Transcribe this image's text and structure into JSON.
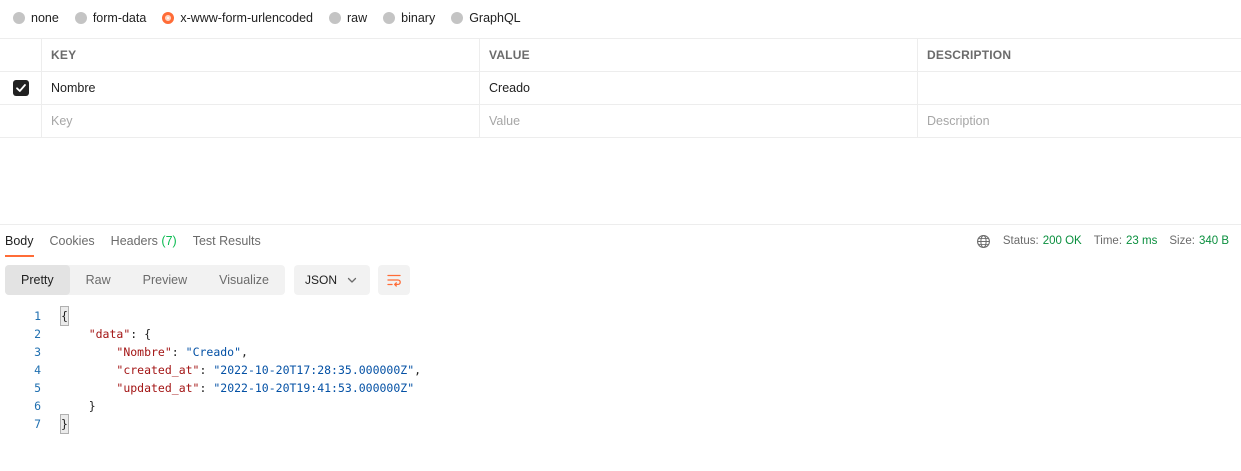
{
  "body_types": [
    {
      "label": "none",
      "selected": false
    },
    {
      "label": "form-data",
      "selected": false
    },
    {
      "label": "x-www-form-urlencoded",
      "selected": true
    },
    {
      "label": "raw",
      "selected": false
    },
    {
      "label": "binary",
      "selected": false
    },
    {
      "label": "GraphQL",
      "selected": false
    }
  ],
  "params_table": {
    "headers": {
      "key": "KEY",
      "value": "VALUE",
      "description": "DESCRIPTION"
    },
    "rows": [
      {
        "checked": true,
        "key": "Nombre",
        "value": "Creado",
        "description": ""
      }
    ],
    "placeholder": {
      "key": "Key",
      "value": "Value",
      "description": "Description"
    }
  },
  "response_tabs": {
    "body": "Body",
    "cookies": "Cookies",
    "headers": "Headers",
    "headers_count": "(7)",
    "test_results": "Test Results"
  },
  "status": {
    "status_label": "Status:",
    "status_value": "200 OK",
    "time_label": "Time:",
    "time_value": "23 ms",
    "size_label": "Size:",
    "size_value": "340 B"
  },
  "view_modes": {
    "pretty": "Pretty",
    "raw": "Raw",
    "preview": "Preview",
    "visualize": "Visualize"
  },
  "format": {
    "selected": "JSON"
  },
  "code": {
    "line_numbers": [
      "1",
      "2",
      "3",
      "4",
      "5",
      "6",
      "7"
    ],
    "open_brace": "{",
    "data_key": "\"data\"",
    "nombre_key": "\"Nombre\"",
    "nombre_value": "\"Creado\"",
    "created_key": "\"created_at\"",
    "created_value": "\"2022-10-20T17:28:35.000000Z\"",
    "updated_key": "\"updated_at\"",
    "updated_value": "\"2022-10-20T19:41:53.000000Z\"",
    "close_inner": "}",
    "close_brace": "}"
  },
  "colors": {
    "accent": "#ff6c37",
    "success": "#0a8f3e",
    "key": "#a31515",
    "string": "#0451a5"
  }
}
